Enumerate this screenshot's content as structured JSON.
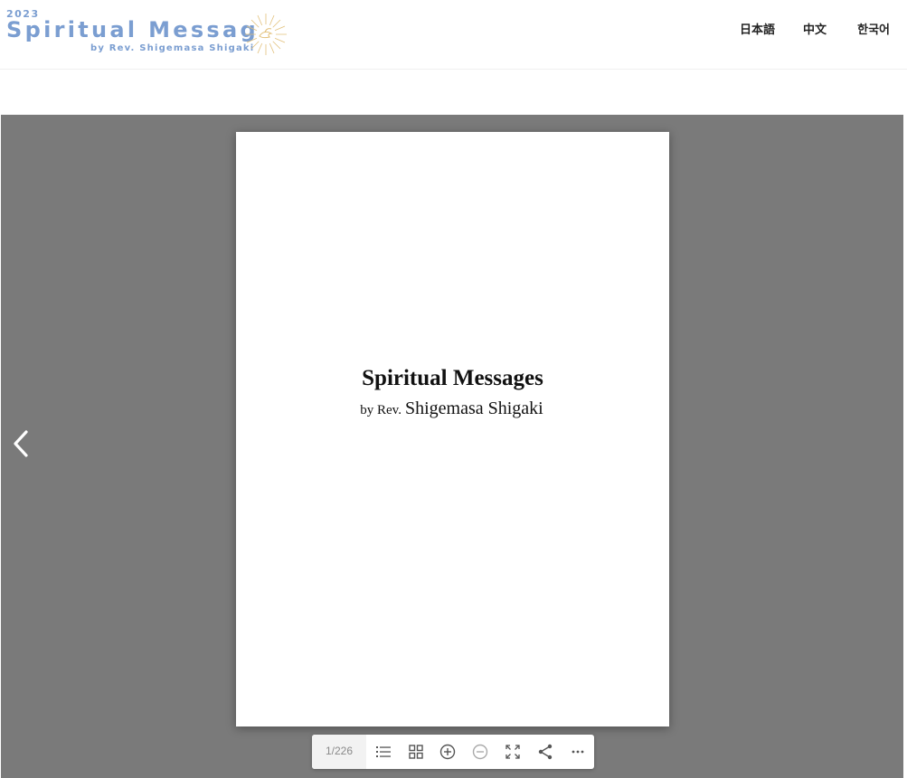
{
  "header": {
    "logo": {
      "year": "2023",
      "title": "Spiritual Message",
      "subtitle": "by Rev. Shigemasa Shigaki",
      "color": "#7b9ed1",
      "emblem_icon": "sunburst-dove-icon"
    },
    "languages": [
      {
        "label": "日本語"
      },
      {
        "label": "中文"
      },
      {
        "label": "한국어"
      }
    ]
  },
  "viewer": {
    "background": "#7a7a7a",
    "prev_icon": "chevron-left-icon",
    "page": {
      "title": "Spiritual Messages",
      "subtitle_by": "by Rev.",
      "subtitle_name": "Shigemasa Shigaki"
    },
    "toolbar": {
      "page_counter": "1/226",
      "buttons": [
        {
          "icon": "list-icon",
          "label": "Table of contents"
        },
        {
          "icon": "grid-icon",
          "label": "Thumbnails"
        },
        {
          "icon": "zoom-in-icon",
          "label": "Zoom in"
        },
        {
          "icon": "zoom-out-icon",
          "label": "Zoom out"
        },
        {
          "icon": "fullscreen-icon",
          "label": "Fullscreen"
        },
        {
          "icon": "share-icon",
          "label": "Share"
        },
        {
          "icon": "more-icon",
          "label": "More"
        }
      ]
    }
  }
}
